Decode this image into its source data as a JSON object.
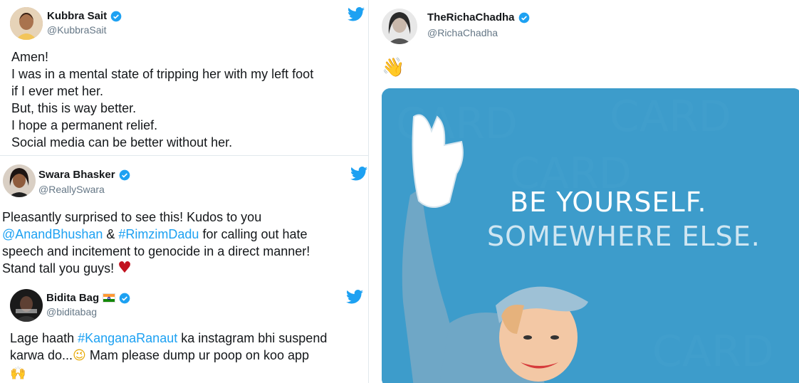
{
  "tweets": {
    "kubbra": {
      "name": "Kubbra Sait",
      "handle": "@KubbraSait",
      "lines": [
        "Amen!",
        "I was in a mental state of tripping her with my left foot",
        "if I ever met her.",
        "But, this is way better.",
        "I hope a permanent relief.",
        "Social media can be better without her."
      ]
    },
    "swara": {
      "name": "Swara Bhasker",
      "handle": "@ReallySwara",
      "line1_prefix": "Pleasantly surprised to see this! Kudos to you",
      "mention": "@AnandBhushan",
      "amp": " & ",
      "hashtag": "#RimzimDadu",
      "line2_suffix": " for calling out hate",
      "line3": "speech and incitement to genocide in a direct manner!",
      "line4": "Stand tall you guys! ",
      "heart": "♥"
    },
    "bidita": {
      "name": "Bidita Bag",
      "handle": "@biditabag",
      "line1_prefix": "Lage haath ",
      "hashtag": "#KanganaRanaut",
      "line1_suffix": " ka instagram bhi suspend",
      "line2": "karwa do...",
      "wink": "😉",
      "line2_suffix": " Mam please dump ur poop on koo app",
      "hands": "🙌"
    },
    "richa": {
      "name": "TheRichaChadha",
      "handle": "@RichaChadha",
      "emoji": "👋",
      "poster_line1": "BE YOURSELF.",
      "poster_line2": "SOMEWHERE ELSE."
    }
  },
  "colors": {
    "twitter_blue": "#1da1f2",
    "poster_blue": "#3d9ccb",
    "heart_red": "#c1121f"
  },
  "icons": [
    "twitter-bird-icon",
    "verified-badge-icon",
    "india-flag-icon"
  ]
}
